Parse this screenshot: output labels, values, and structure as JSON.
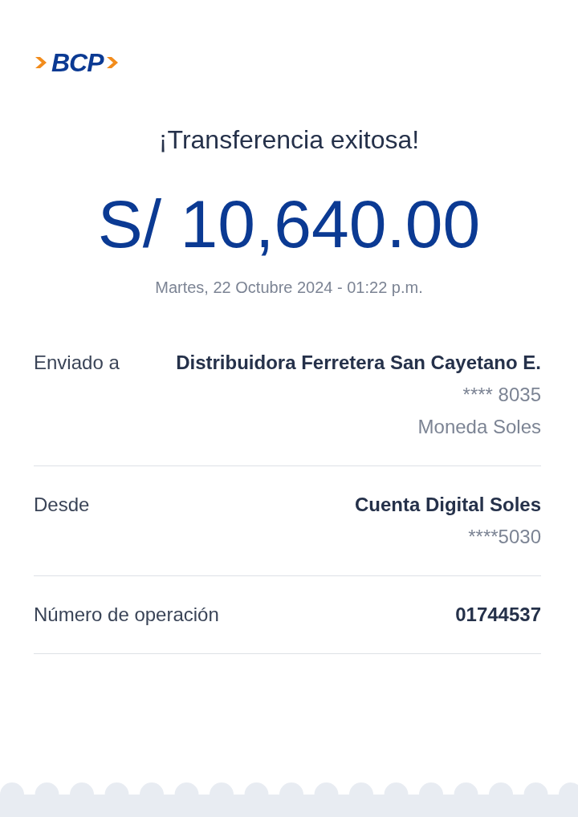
{
  "logo": {
    "text": "BCP"
  },
  "title": "¡Transferencia exitosa!",
  "amount": "S/ 10,640.00",
  "date": "Martes, 22 Octubre 2024 - 01:22 p.m.",
  "details": [
    {
      "label": "Enviado a",
      "value": "Distribuidora Ferretera San Cayetano E.",
      "lines": [
        "**** 8035",
        "Moneda Soles"
      ]
    },
    {
      "label": "Desde",
      "value": "Cuenta Digital Soles",
      "lines": [
        "****5030"
      ]
    },
    {
      "label": "Número de operación",
      "value": "01744537"
    }
  ]
}
